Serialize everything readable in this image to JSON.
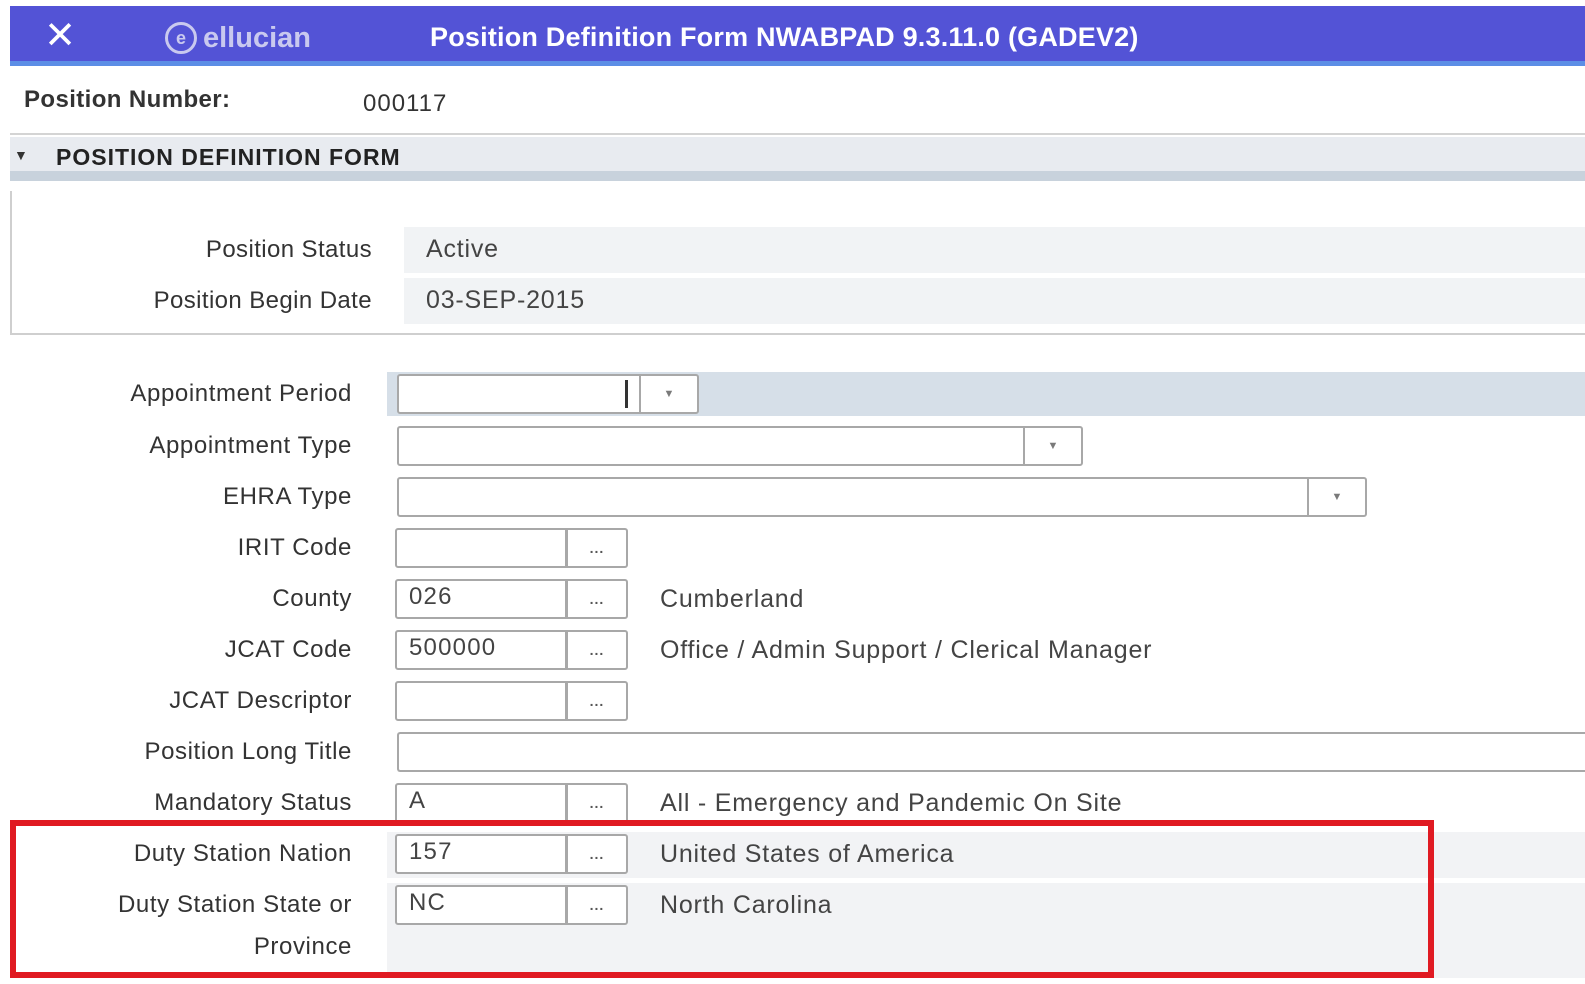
{
  "header": {
    "close_icon": "close-icon",
    "logo_mark": "e",
    "logo_text": "ellucian",
    "title": "Position Definition Form NWABPAD 9.3.11.0 (GADEV2)",
    "background_color": "#5353d6"
  },
  "key_block": {
    "position_number_label": "Position Number:",
    "position_number_value": "000117"
  },
  "section": {
    "title": "POSITION DEFINITION FORM",
    "collapse_icon": "triangle-down-icon"
  },
  "status": {
    "position_status_label": "Position Status",
    "position_status_value": "Active",
    "begin_date_label": "Position Begin Date",
    "begin_date_value": "03-SEP-2015"
  },
  "form": {
    "appointment_period": {
      "label": "Appointment Period",
      "value": ""
    },
    "appointment_type": {
      "label": "Appointment Type",
      "value": ""
    },
    "ehra_type": {
      "label": "EHRA Type",
      "value": ""
    },
    "irit_code": {
      "label": "IRIT Code",
      "value": "",
      "description": ""
    },
    "county": {
      "label": "County",
      "value": "026",
      "description": "Cumberland"
    },
    "jcat_code": {
      "label": "JCAT Code",
      "value": "500000",
      "description": "Office / Admin Support / Clerical Manager"
    },
    "jcat_descriptor": {
      "label": "JCAT Descriptor",
      "value": "",
      "description": ""
    },
    "position_long_title": {
      "label": "Position Long Title",
      "value": ""
    },
    "mandatory_status": {
      "label": "Mandatory Status",
      "value": "A",
      "description": "All - Emergency and Pandemic On Site"
    },
    "duty_station_nation": {
      "label": "Duty Station Nation",
      "value": "157",
      "description": "United States of America"
    },
    "duty_station_state": {
      "label_line1": "Duty Station State or",
      "label_line2": "Province",
      "value": "NC",
      "description": "North Carolina"
    }
  },
  "lookup_button_text": "...",
  "dropdown_arrow": "▼",
  "highlight_color": "#e01a22"
}
